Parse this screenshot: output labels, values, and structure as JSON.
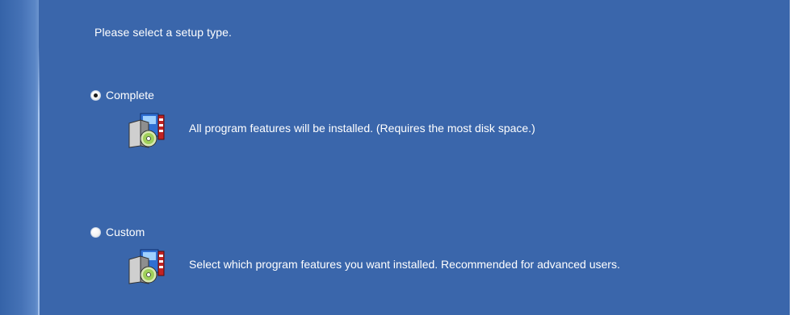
{
  "prompt": "Please select a setup type.",
  "options": [
    {
      "label": "Complete",
      "selected": true,
      "description": "All program features will be installed. (Requires the most disk space.)",
      "icon": "install-package-icon"
    },
    {
      "label": "Custom",
      "selected": false,
      "description": "Select which program features you want installed. Recommended for advanced users.",
      "icon": "install-package-icon"
    }
  ],
  "colors": {
    "background": "#3a66ab",
    "text": "#ffffff",
    "divider": "#a9c6ee"
  }
}
